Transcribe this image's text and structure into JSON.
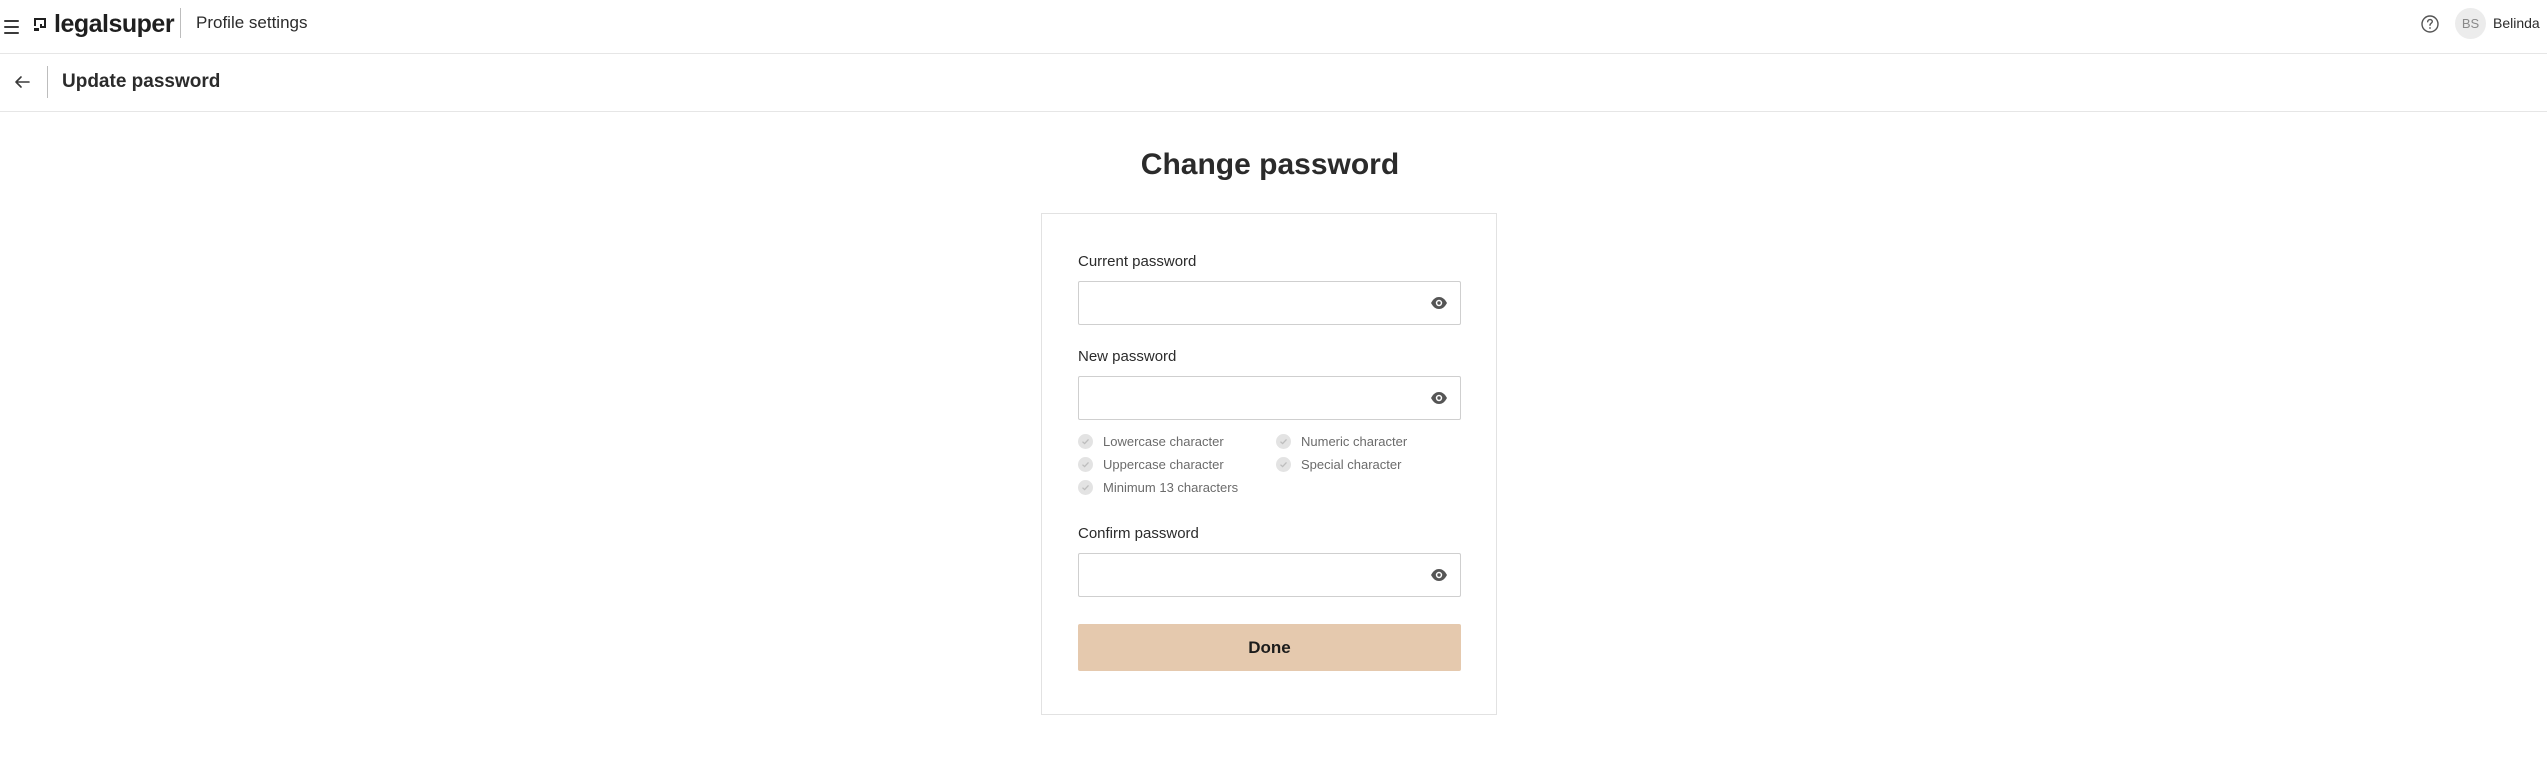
{
  "header": {
    "brand": "legalsuper",
    "title": "Profile settings",
    "user": {
      "initials": "BS",
      "name": "Belinda"
    }
  },
  "subheader": {
    "title": "Update password"
  },
  "main": {
    "heading": "Change password",
    "fields": {
      "current": {
        "label": "Current password",
        "value": ""
      },
      "new": {
        "label": "New password",
        "value": ""
      },
      "confirm": {
        "label": "Confirm password",
        "value": ""
      }
    },
    "requirements": {
      "lowercase": "Lowercase character",
      "uppercase": "Uppercase character",
      "minimum": "Minimum 13 characters",
      "numeric": "Numeric character",
      "special": "Special character"
    },
    "done_label": "Done"
  },
  "colors": {
    "done_button": "#e5c9ae",
    "requirement_check": "#e3e3e3"
  }
}
